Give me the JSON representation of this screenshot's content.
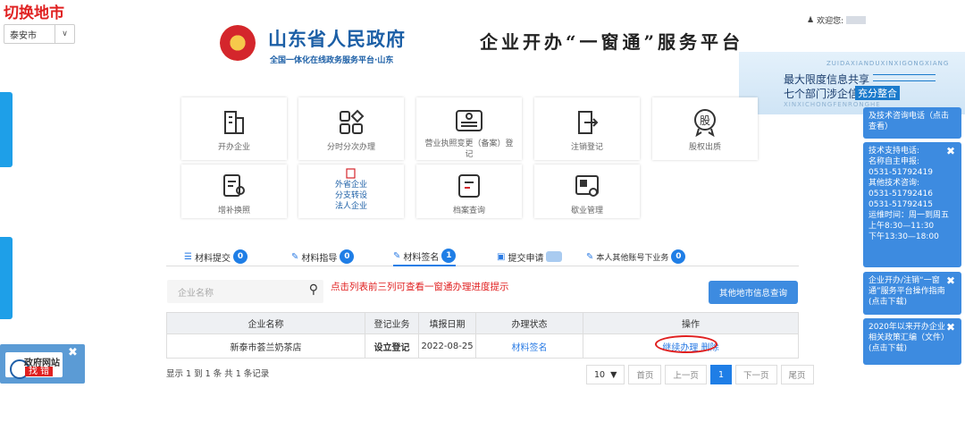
{
  "city": {
    "title": "切换地市",
    "selected": "泰安市"
  },
  "left_tabs": {
    "error_report_line1": "政府网站",
    "error_report_line2": "找 错"
  },
  "header": {
    "gov_name": "山东省人民政府",
    "gov_subtitle": "全国一体化在线政务服务平台·山东",
    "platform_title": "企业开办“一窗通”服务平台",
    "welcome": "欢迎您:"
  },
  "banner": {
    "pinyin_top": "ZUIDAXIANDUXINXIGONGXIANG",
    "line1": "最大限度信息共享",
    "line2": "七个部门涉企信息",
    "badge": "充分整合",
    "pinyin_bottom": "XINXICHONGFENRONGHE"
  },
  "tiles": {
    "open": "开办企业",
    "phased": "分时分次办理",
    "license_change": "营业执照变更（备案）登记",
    "cancel": "注销登记",
    "equity": "股权出质",
    "reissue": "增补换照",
    "branch_l1": "外省企业",
    "branch_l2": "分支转设",
    "branch_l3": "法人企业",
    "archive": "档案查询",
    "closure": "歇业管理"
  },
  "right_panel": {
    "r1": "及技术咨询电话（点击查看）",
    "r2_title": "技术支持电话:",
    "r2_l1": "名称自主申报:",
    "r2_l2": "0531-51792419",
    "r2_l3": "其他技术咨询:",
    "r2_l4": "0531-51792416",
    "r2_l5": "0531-51792415",
    "r2_l6": "运维时间：周一到周五",
    "r2_l7": "上午8:30—11:30",
    "r2_l8": "下午13:30—18:00",
    "r3": "企业开办/注销“一窗通”服务平台操作指南(点击下载)",
    "r4": "2020年以来开办企业相关政策汇编（文件）(点击下载)"
  },
  "tabs": {
    "submit": "材料提交",
    "submit_count": "0",
    "guide": "材料指导",
    "guide_count": "0",
    "sign": "材料签名",
    "sign_count": "1",
    "apply": "提交申请",
    "others": "本人其他账号下业务",
    "others_count": "0"
  },
  "search": {
    "placeholder": "企业名称",
    "hint": "点击列表前三列可查看一窗通办理进度提示",
    "other_city_button": "其他地市信息查询"
  },
  "table": {
    "headers": [
      "企业名称",
      "登记业务",
      "填报日期",
      "办理状态",
      "操作"
    ],
    "rows": [
      {
        "name": "新泰市荟兰奶茶店",
        "business": "设立登记",
        "date": "2022-08-25",
        "status": "材料签名",
        "continue": "继续办理",
        "delete": "删除"
      }
    ]
  },
  "pagination": {
    "summary": "显示 1 到 1 条 共 1 条记录",
    "page_size": "10",
    "first": "首页",
    "prev": "上一页",
    "current": "1",
    "next": "下一页",
    "last": "尾页"
  }
}
